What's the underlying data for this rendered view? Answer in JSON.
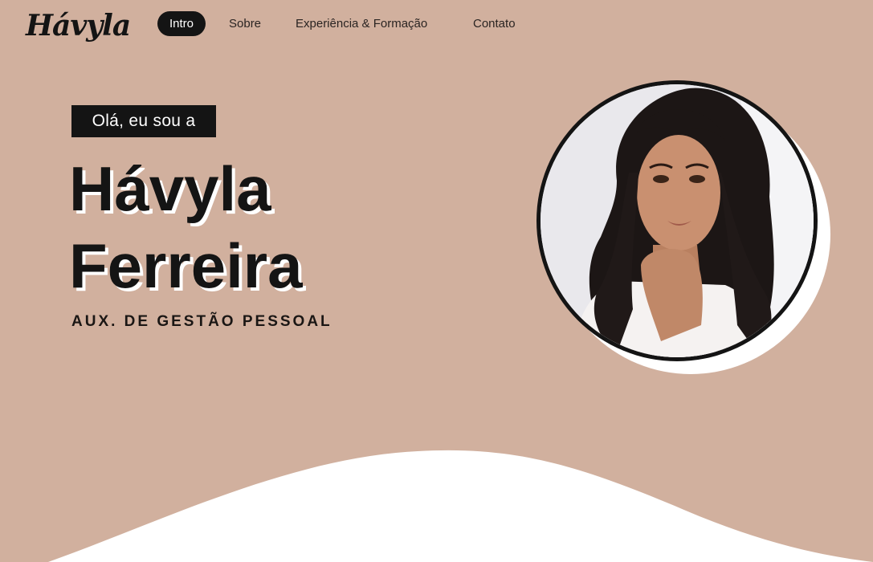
{
  "brand": {
    "logo_text": "Hávyla"
  },
  "nav": {
    "items": [
      {
        "label": "Intro",
        "active": true
      },
      {
        "label": "Sobre",
        "active": false
      },
      {
        "label": "Experiência & Formação",
        "active": false
      },
      {
        "label": "Contato",
        "active": false
      }
    ]
  },
  "hero": {
    "greeting": "Olá, eu sou a",
    "first_name": "Hávyla",
    "last_name": "Ferreira",
    "role": "AUX. DE GESTÃO PESSOAL"
  },
  "colors": {
    "background": "#d1b09e",
    "dark": "#141414",
    "white": "#ffffff"
  }
}
